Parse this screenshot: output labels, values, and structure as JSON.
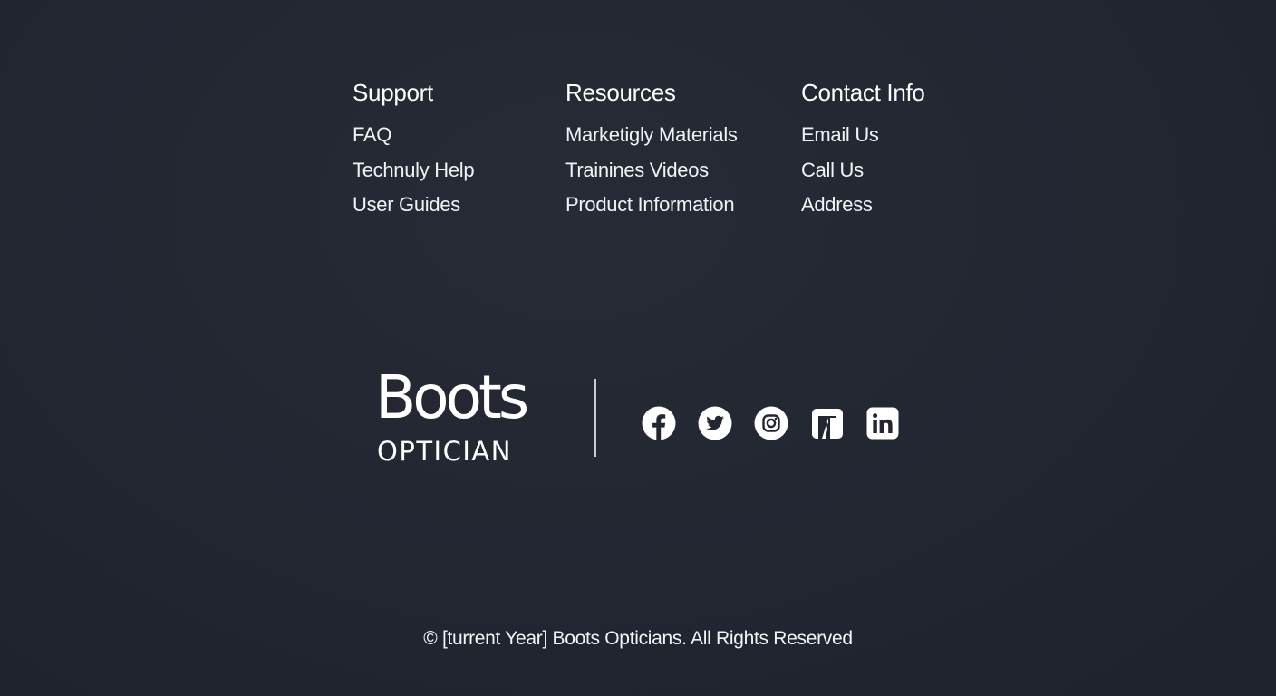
{
  "columns": {
    "support": {
      "title": "Support",
      "links": [
        "FAQ",
        "Technuly Help",
        "User Guides"
      ]
    },
    "resources": {
      "title": "Resources",
      "links": [
        "Marketigly Materials",
        "Trainines Videos",
        "Product Information"
      ]
    },
    "contact": {
      "title": "Contact Info",
      "links": [
        "Email Us",
        "Call Us",
        "Address"
      ]
    }
  },
  "brand": {
    "name": "Boots",
    "subtitle": "OPTICIAN"
  },
  "social": [
    "facebook-icon",
    "twitter-icon",
    "instagram-icon",
    "brand-square-icon",
    "linkedin-icon"
  ],
  "copyright": "© [turrent Year] Boots Opticians. All Rights Reserved",
  "colors": {
    "background": "#212530",
    "text": "#ffffff"
  }
}
